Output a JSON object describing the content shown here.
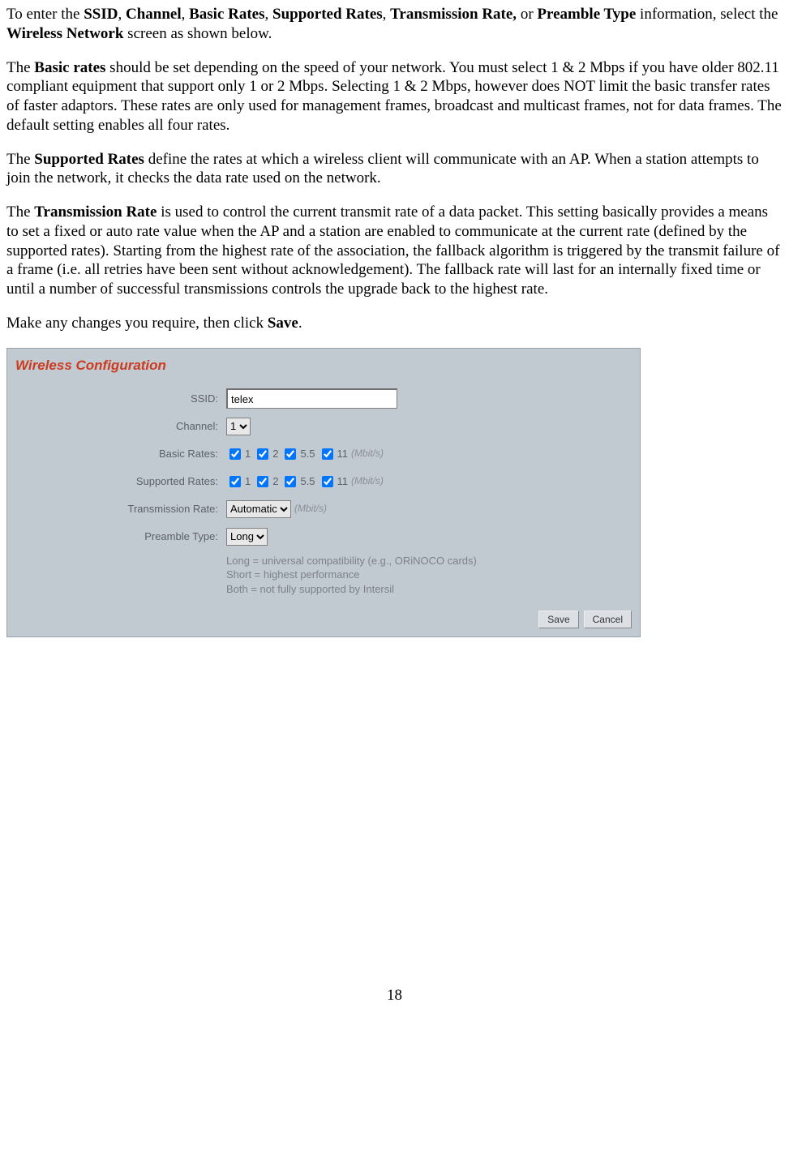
{
  "doc": {
    "intro": {
      "prefix": "To enter the  ",
      "b1": "SSID",
      "sep1": ", ",
      "b2": "Channel",
      "sep2": ", ",
      "b3": "Basic Rates",
      "sep3": ", ",
      "b4": "Supported Rates",
      "sep4": ", ",
      "b5": "Transmission Rate,",
      "sep5": " or ",
      "b6": "Preamble Type",
      "mid": " information, select the ",
      "b7": "Wireless Network",
      "tail": " screen as shown below."
    },
    "basic_label": "Basic rates",
    "basic_text_prefix": "The ",
    "basic_text_rest": " should be set depending on the speed of your network.  You must select 1 & 2 Mbps if you have older 802.11 compliant equipment that support only 1 or 2 Mbps.  Selecting 1 & 2 Mbps, however does NOT limit the basic transfer rates of faster adaptors.  These rates are only used for management frames, broadcast and multicast frames, not for data frames. The default setting enables all four rates.",
    "supported_label": "Supported Rates",
    "supported_text_prefix": "The ",
    "supported_text_rest": " define the rates at which a wireless client will communicate with an AP.  When a station attempts to join the network, it checks the data rate used on the network.",
    "trans_label": "Transmission Rate",
    "trans_text_prefix": "The ",
    "trans_text_rest": " is used to control the current transmit rate of a data packet.  This setting basically provides a means to set a fixed or auto rate value when the AP and a station are enabled to communicate at the current rate (defined by the supported rates).  Starting from the highest rate of the association, the fallback algorithm is triggered by the transmit failure of a frame (i.e. all retries have been sent without acknowledgement).  The fallback rate will last for an internally fixed time or until a number of successful transmissions controls the upgrade back to the highest rate.",
    "save_prefix": "Make any changes you require, then click ",
    "save_bold": "Save",
    "save_suffix": "."
  },
  "panel": {
    "title": "Wireless Configuration",
    "rows": {
      "ssid_label": "SSID:",
      "ssid_value": "telex",
      "channel_label": "Channel:",
      "channel_value": "1",
      "basic_label": "Basic Rates:",
      "supported_label": "Supported Rates:",
      "trans_label": "Transmission Rate:",
      "trans_value": "Automatic",
      "preamble_label": "Preamble Type:",
      "preamble_value": "Long"
    },
    "rates": {
      "r1": "1",
      "r2": "2",
      "r3": "5.5",
      "r4": "11"
    },
    "unit": "(Mbit/s)",
    "hints": {
      "line1": "Long = universal compatibility (e.g., ORiNOCO cards)",
      "line2": "Short = highest performance",
      "line3": "Both = not fully supported by Intersil"
    },
    "buttons": {
      "save": "Save",
      "cancel": "Cancel"
    }
  },
  "page_number": "18"
}
